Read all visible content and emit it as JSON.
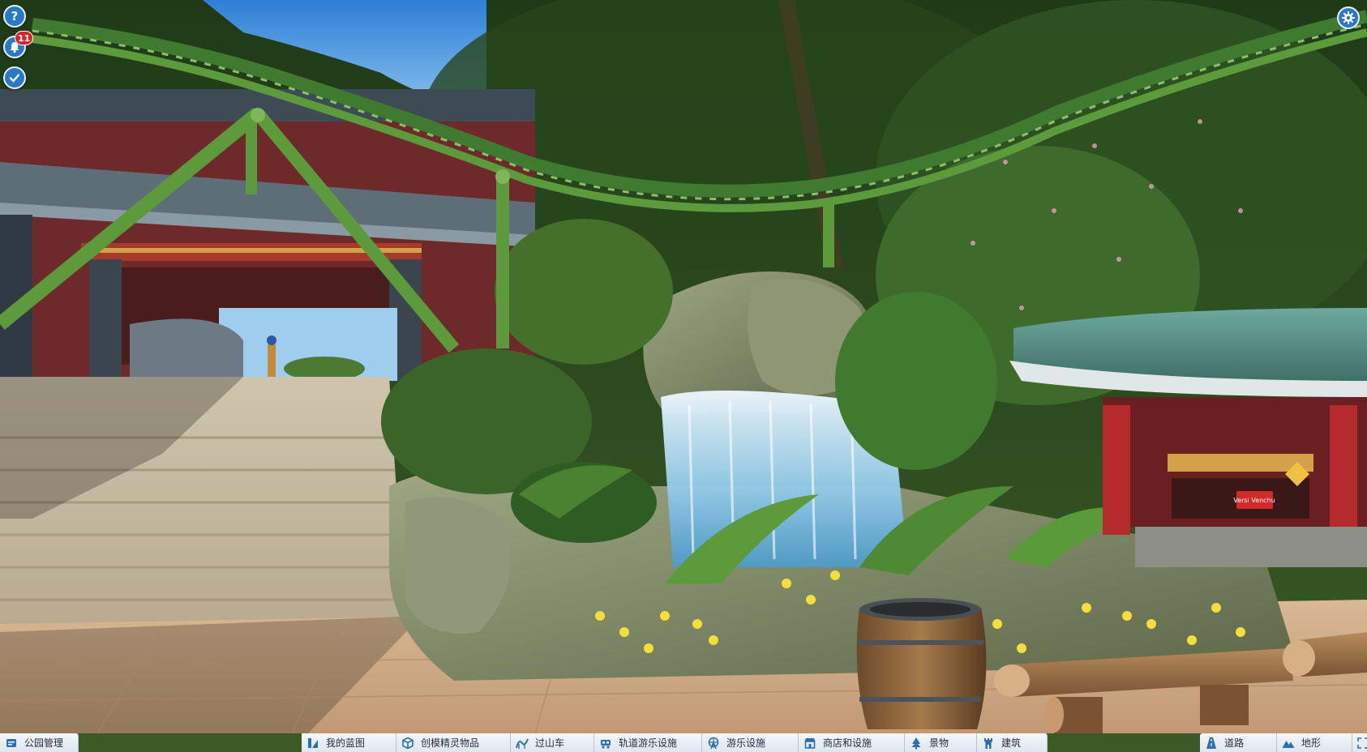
{
  "hud": {
    "help_glyph": "?",
    "notification_count": "11",
    "icons": [
      "help-icon",
      "bell-icon",
      "checkmark-icon",
      "gear-icon"
    ]
  },
  "toolbar_left": {
    "park_management": "公园管理"
  },
  "toolbar_center": [
    {
      "label": "我的蓝图",
      "icon": "blueprint-icon"
    },
    {
      "label": "创模精灵物品",
      "icon": "cube-icon"
    },
    {
      "label": "过山车",
      "icon": "coaster-icon"
    },
    {
      "label": "轨道游乐设施",
      "icon": "train-icon"
    },
    {
      "label": "游乐设施",
      "icon": "ferris-wheel-icon"
    },
    {
      "label": "商店和设施",
      "icon": "shop-icon"
    },
    {
      "label": "景物",
      "icon": "tree-icon"
    },
    {
      "label": "建筑",
      "icon": "tower-icon"
    }
  ],
  "toolbar_right": [
    {
      "label": "道路",
      "icon": "path-icon"
    },
    {
      "label": "地形",
      "icon": "terrain-icon"
    }
  ],
  "scene": {
    "shop_sign": "Versi Venchu",
    "colors": {
      "toolbar_bg": "#e6ecf3",
      "hud_blue": "#2a78c8",
      "badge_red": "#d8262b",
      "track_green": "#5c9a3c"
    }
  }
}
